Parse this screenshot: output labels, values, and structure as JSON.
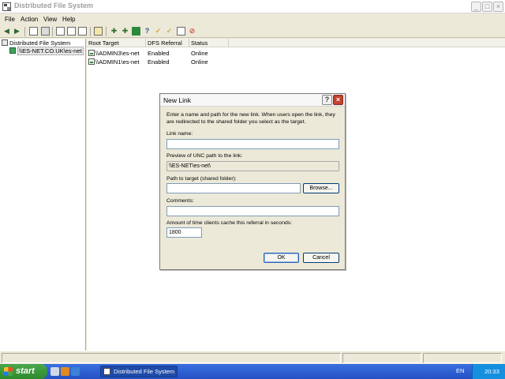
{
  "window": {
    "title": "Distributed File System",
    "controls": {
      "minimize": "_",
      "maximize": "□",
      "close": "×"
    }
  },
  "menu": [
    "File",
    "Action",
    "View",
    "Help"
  ],
  "toolbar": {
    "back_icon": "arrow-left-icon",
    "forward_icon": "arrow-right-icon",
    "help_glyph": "?"
  },
  "tree": {
    "root": "Distributed File System",
    "child": "\\\\ES-NET.CO.UK\\es-net"
  },
  "list": {
    "headers": [
      "Root Target",
      "DFS Referral",
      "Status"
    ],
    "rows": [
      {
        "target": "\\\\ADMIN3\\es-net",
        "referral": "Enabled",
        "status": "Online"
      },
      {
        "target": "\\\\ADMIN1\\es-net",
        "referral": "Enabled",
        "status": "Online"
      }
    ]
  },
  "dialog": {
    "title": "New Link",
    "help_glyph": "?",
    "close_glyph": "×",
    "instructions": "Enter a name and path for the new link. When users open the link, they are redirected to the shared folder you select as the target.",
    "link_name_label": "Link name:",
    "link_name_value": "",
    "preview_label": "Preview of UNC path to the link:",
    "preview_value": "\\\\ES-NET\\es-net\\",
    "path_label": "Path to target (shared folder):",
    "path_value": "",
    "browse_label": "Browse...",
    "comments_label": "Comments:",
    "comments_value": "",
    "cache_label": "Amount of time clients cache this referral in seconds:",
    "cache_value": "1800",
    "ok_label": "OK",
    "cancel_label": "Cancel"
  },
  "taskbar": {
    "start_label": "start",
    "task_label": "Distributed File System",
    "language": "EN",
    "clock": "20:33"
  }
}
